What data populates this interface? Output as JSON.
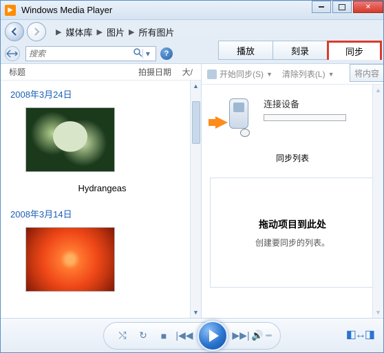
{
  "title": "Windows Media Player",
  "breadcrumb": [
    "媒体库",
    "图片",
    "所有图片"
  ],
  "tabs": {
    "play": "播放",
    "burn": "刻录",
    "sync": "同步"
  },
  "search": {
    "placeholder": "搜索"
  },
  "columns": {
    "title": "标题",
    "date": "拍摄日期",
    "size": "大/"
  },
  "groups": [
    {
      "date": "2008年3月24日",
      "items": [
        {
          "name": "Hydrangeas"
        }
      ]
    },
    {
      "date": "2008年3月14日",
      "items": [
        {
          "name": ""
        }
      ]
    }
  ],
  "syncbar": {
    "start": "开始同步(S)",
    "clear": "清除列表(L)"
  },
  "rightExtra": "将内容",
  "device": {
    "label": "连接设备"
  },
  "syncList": {
    "title": "同步列表",
    "line1": "拖动项目到此处",
    "line2": "创建要同步的列表。"
  }
}
